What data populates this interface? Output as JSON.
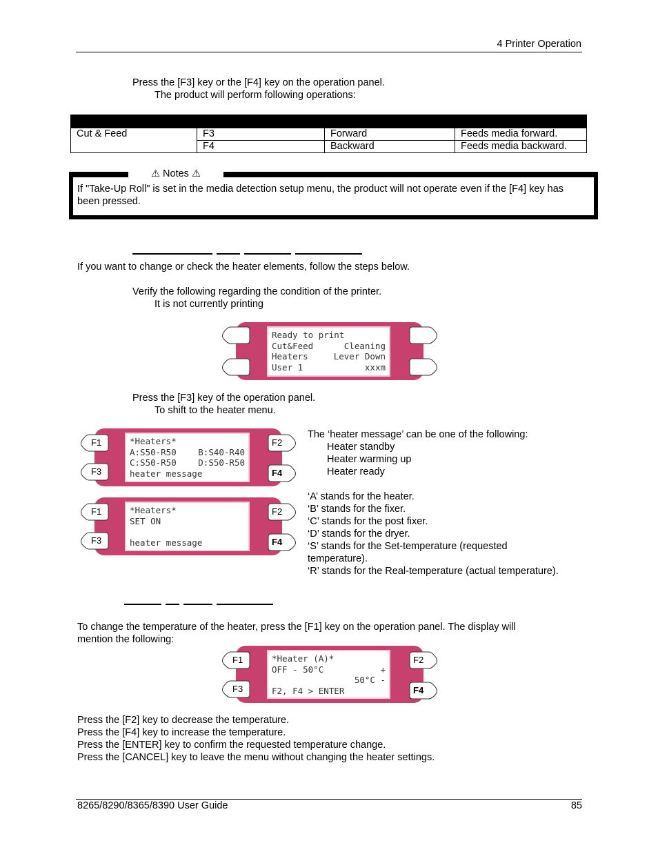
{
  "header": {
    "chapter": "4 Printer Operation"
  },
  "section1": {
    "step": "Press the [F3] key or the [F4] key on the operation panel.",
    "substep": "The product will perform following operations:",
    "table": {
      "rows": [
        [
          "Cut & Feed",
          "F3",
          "Forward",
          "Feeds media forward."
        ],
        [
          "",
          "F4",
          "Backward",
          "Feeds media backward."
        ]
      ]
    }
  },
  "notes": {
    "title": "Notes",
    "icon": "warning-icon",
    "text": "If \"Take-Up Roll\" is set in the media detection setup menu, the product will not operate even if the [F4] key has been pressed."
  },
  "section2": {
    "intro": "If you want to change or check the heater elements, follow the steps below.",
    "step1": "Verify the following regarding the condition of the printer.",
    "step1_sub": "It is not currently printing",
    "panel_ready": {
      "lines": [
        [
          "Ready to print",
          ""
        ],
        [
          "Cut&Feed",
          "Cleaning"
        ],
        [
          "Heaters",
          "Lever Down"
        ],
        [
          "User 1",
          "xxxm"
        ]
      ]
    },
    "step2": "Press the [F3] key of the operation panel.",
    "step2_sub": "To shift to the heater menu.",
    "panel_heaters1": {
      "lines": [
        [
          "*Heaters*",
          ""
        ],
        [
          "A:S50-R50",
          "B:S40-R40"
        ],
        [
          "C:S50-R50",
          "D:S50-R50"
        ],
        [
          "heater message",
          ""
        ]
      ],
      "keys": [
        "F1",
        "F2",
        "F3",
        "F4"
      ]
    },
    "panel_heaters2": {
      "lines": [
        [
          "*Heaters*",
          ""
        ],
        [
          "SET ON",
          ""
        ],
        [
          "",
          ""
        ],
        [
          "heater message",
          ""
        ]
      ],
      "keys": [
        "F1",
        "F2",
        "F3",
        "F4"
      ]
    },
    "message_intro": "The ‘heater message’ can be one of the following:",
    "messages": [
      "Heater standby",
      "Heater warming up",
      "Heater ready"
    ],
    "legend": [
      "‘A’ stands for the heater.",
      "‘B’ stands for the fixer.",
      "‘C’ stands for the post fixer.",
      "‘D’ stands for the dryer.",
      "‘S’ stands for the Set-temperature (requested",
      "temperature).",
      "‘R’ stands for the Real-temperature (actual temperature)."
    ]
  },
  "section3": {
    "intro_line1": "To change the temperature of the heater, press the [F1] key on the operation panel.  The display will",
    "intro_line2": "mention the following:",
    "panel_temp": {
      "lines": [
        [
          "*Heater (A)*",
          ""
        ],
        [
          "OFF - 50°C",
          "+"
        ],
        [
          "",
          "50°C -"
        ],
        [
          "F2, F4 > ENTER",
          ""
        ]
      ],
      "keys": [
        "F1",
        "F2",
        "F3",
        "F4"
      ]
    },
    "instructions": [
      "Press the [F2] key to decrease the temperature.",
      "Press the [F4] key to increase the temperature.",
      "Press the [ENTER] key to confirm the requested temperature change.",
      "Press the [CANCEL] key to leave the menu without changing the heater settings."
    ]
  },
  "footer": {
    "title": "8265/8290/8365/8390 User Guide",
    "page": "85"
  },
  "colors": {
    "panel": "#c8406e",
    "lcd_border": "#f6c9d7"
  }
}
